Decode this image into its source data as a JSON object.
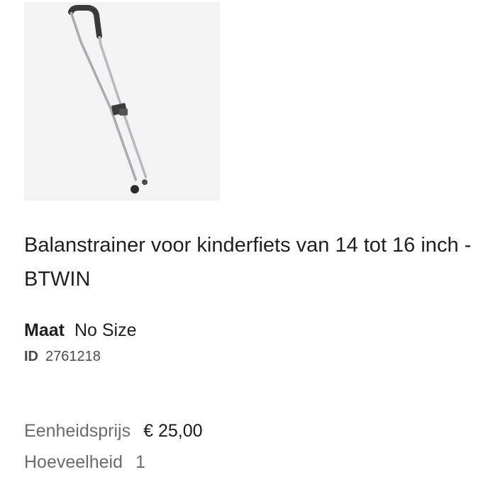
{
  "product": {
    "image_alt": "Balanstrainer",
    "title": "Balanstrainer voor kinderfiets van 14 tot 16 inch - BTWIN"
  },
  "size": {
    "label": "Maat",
    "value": "No Size"
  },
  "id": {
    "label": "ID",
    "value": "2761218"
  },
  "price": {
    "label": "Eenheidsprijs",
    "value": "€ 25,00"
  },
  "quantity": {
    "label": "Hoeveelheid",
    "value": "1"
  },
  "colors": {
    "image_background": "#f3f3f3",
    "text": "#1f1f1f",
    "muted_text": "#6b6b6b"
  }
}
